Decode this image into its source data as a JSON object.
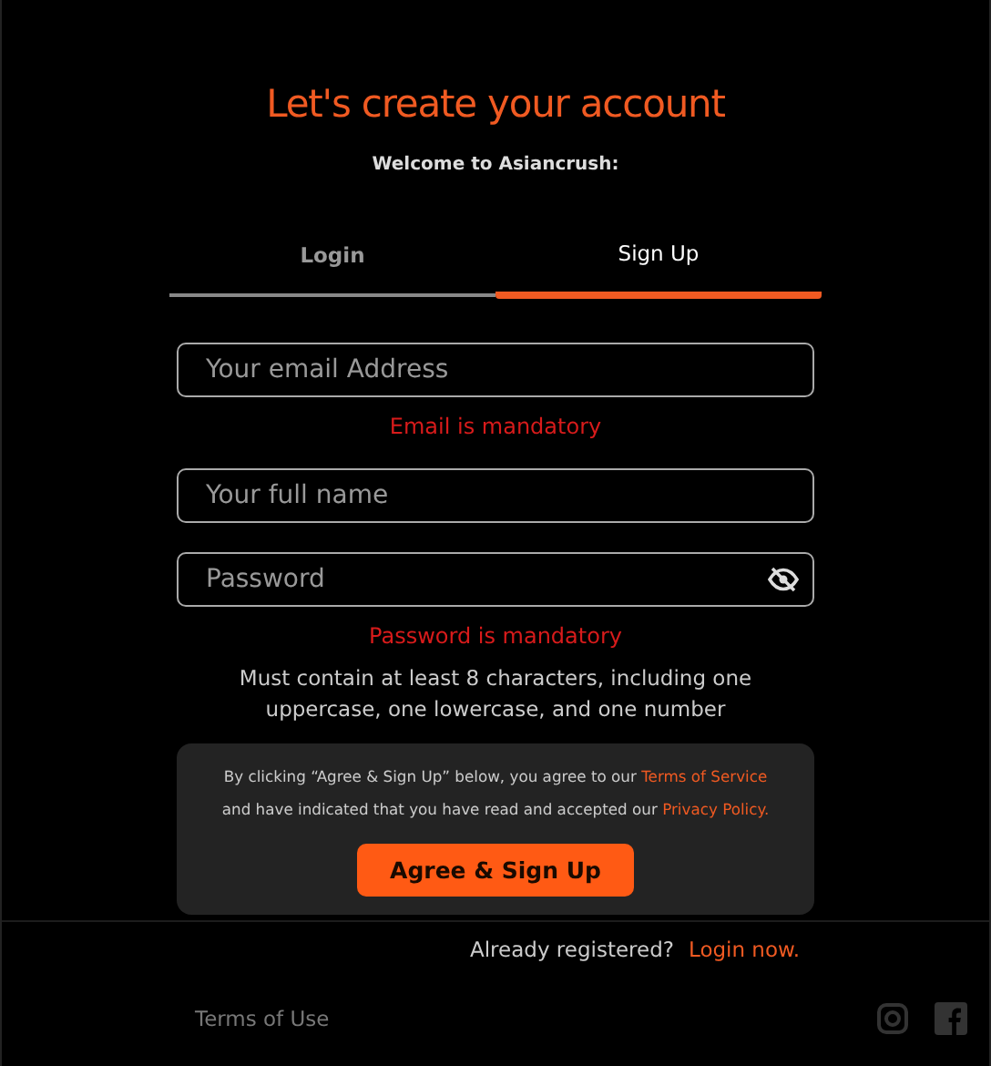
{
  "title": "Let's create your account",
  "subtitle": "Welcome to Asiancrush:",
  "tabs": [
    {
      "label": "Login",
      "selected": false
    },
    {
      "label": "Sign Up",
      "selected": true
    }
  ],
  "fields": [
    {
      "placeholder": "Your email Address",
      "kind": "text",
      "error": "Email is mandatory"
    },
    {
      "placeholder": "Your full name",
      "kind": "text"
    },
    {
      "placeholder": "Password",
      "kind": "password",
      "error": "Password is mandatory",
      "hint": "Must contain at least 8 characters, including one uppercase, one lowercase, and one number"
    }
  ],
  "consent": {
    "text": "By clicking “Agree & Sign Up” below, you agree to our",
    "terms_link": "Terms of Service",
    "middle": "and have indicated that you have read and accepted our",
    "privacy_link": "Privacy Policy.",
    "button": "Agree & Sign Up"
  },
  "login_prompt": {
    "text": "Already registered?",
    "link": "Login now."
  },
  "footer": {
    "link": "Terms of Use"
  }
}
